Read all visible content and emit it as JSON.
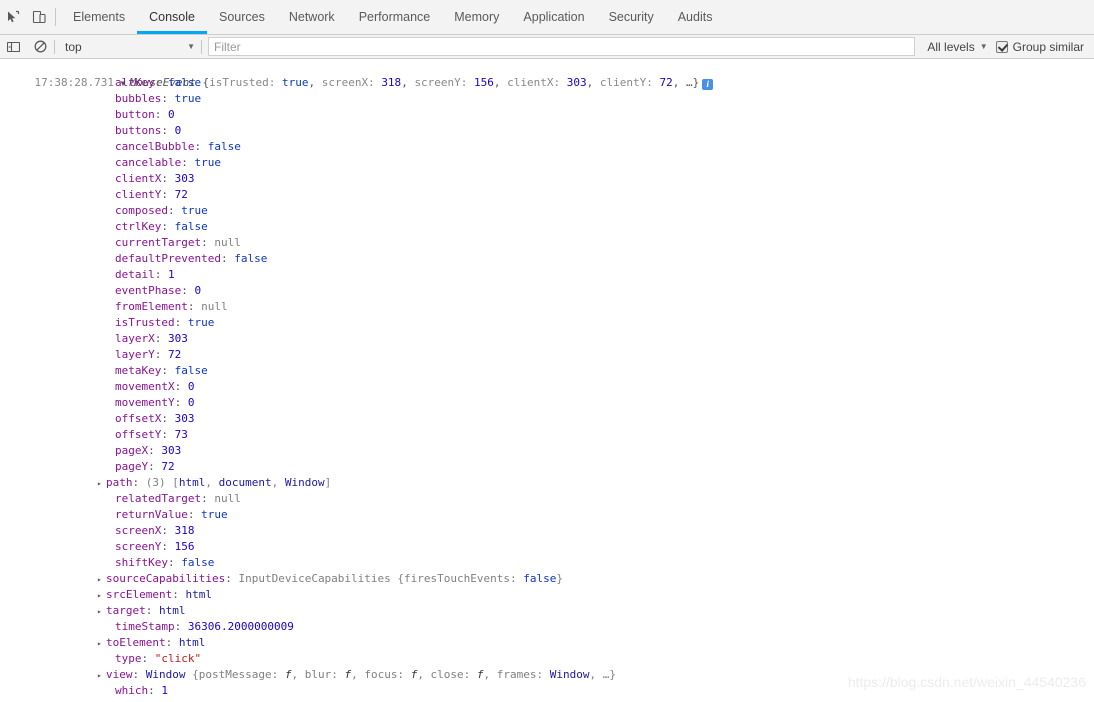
{
  "theme": {
    "accent": "#00a8f0"
  },
  "tabbar": {
    "icons": [
      {
        "name": "inspect-element-icon"
      },
      {
        "name": "device-toolbar-icon"
      }
    ],
    "tabs": [
      {
        "label": "Elements",
        "active": false
      },
      {
        "label": "Console",
        "active": true
      },
      {
        "label": "Sources",
        "active": false
      },
      {
        "label": "Network",
        "active": false
      },
      {
        "label": "Performance",
        "active": false
      },
      {
        "label": "Memory",
        "active": false
      },
      {
        "label": "Application",
        "active": false
      },
      {
        "label": "Security",
        "active": false
      },
      {
        "label": "Audits",
        "active": false
      }
    ]
  },
  "toolbar": {
    "sidebar_icon": "console-sidebar-icon",
    "clear_icon": "clear-console-icon",
    "context": {
      "value": "top",
      "caret": "▼"
    },
    "filter": {
      "value": "",
      "placeholder": "Filter"
    },
    "levels": {
      "label": "All levels",
      "caret": "▼"
    },
    "group_similar": {
      "label": "Group similar",
      "checked": true
    }
  },
  "console": {
    "message": {
      "timestamp": "17:38:28.731",
      "disclosure": "▼",
      "ctor": "MouseEvent",
      "preview_open": " {",
      "preview": [
        {
          "key": "isTrusted",
          "value": "true",
          "type": "bool"
        },
        {
          "key": "screenX",
          "value": "318",
          "type": "num"
        },
        {
          "key": "screenY",
          "value": "156",
          "type": "num"
        },
        {
          "key": "clientX",
          "value": "303",
          "type": "num"
        },
        {
          "key": "clientY",
          "value": "72",
          "type": "num"
        }
      ],
      "preview_close": ", …}",
      "info_badge": "i"
    },
    "properties": [
      {
        "key": "altKey",
        "value": "false",
        "type": "bool",
        "expandable": false
      },
      {
        "key": "bubbles",
        "value": "true",
        "type": "bool",
        "expandable": false
      },
      {
        "key": "button",
        "value": "0",
        "type": "num",
        "expandable": false
      },
      {
        "key": "buttons",
        "value": "0",
        "type": "num",
        "expandable": false
      },
      {
        "key": "cancelBubble",
        "value": "false",
        "type": "bool",
        "expandable": false
      },
      {
        "key": "cancelable",
        "value": "true",
        "type": "bool",
        "expandable": false
      },
      {
        "key": "clientX",
        "value": "303",
        "type": "num",
        "expandable": false
      },
      {
        "key": "clientY",
        "value": "72",
        "type": "num",
        "expandable": false
      },
      {
        "key": "composed",
        "value": "true",
        "type": "bool",
        "expandable": false
      },
      {
        "key": "ctrlKey",
        "value": "false",
        "type": "bool",
        "expandable": false
      },
      {
        "key": "currentTarget",
        "value": "null",
        "type": "null",
        "expandable": false
      },
      {
        "key": "defaultPrevented",
        "value": "false",
        "type": "bool",
        "expandable": false
      },
      {
        "key": "detail",
        "value": "1",
        "type": "num",
        "expandable": false
      },
      {
        "key": "eventPhase",
        "value": "0",
        "type": "num",
        "expandable": false
      },
      {
        "key": "fromElement",
        "value": "null",
        "type": "null",
        "expandable": false
      },
      {
        "key": "isTrusted",
        "value": "true",
        "type": "bool",
        "expandable": false
      },
      {
        "key": "layerX",
        "value": "303",
        "type": "num",
        "expandable": false
      },
      {
        "key": "layerY",
        "value": "72",
        "type": "num",
        "expandable": false
      },
      {
        "key": "metaKey",
        "value": "false",
        "type": "bool",
        "expandable": false
      },
      {
        "key": "movementX",
        "value": "0",
        "type": "num",
        "expandable": false
      },
      {
        "key": "movementY",
        "value": "0",
        "type": "num",
        "expandable": false
      },
      {
        "key": "offsetX",
        "value": "303",
        "type": "num",
        "expandable": false
      },
      {
        "key": "offsetY",
        "value": "73",
        "type": "num",
        "expandable": false
      },
      {
        "key": "pageX",
        "value": "303",
        "type": "num",
        "expandable": false
      },
      {
        "key": "pageY",
        "value": "72",
        "type": "num",
        "expandable": false
      },
      {
        "key": "path",
        "value": "(3) [html, document, Window]",
        "type": "array",
        "expandable": true
      },
      {
        "key": "relatedTarget",
        "value": "null",
        "type": "null",
        "expandable": false
      },
      {
        "key": "returnValue",
        "value": "true",
        "type": "bool",
        "expandable": false
      },
      {
        "key": "screenX",
        "value": "318",
        "type": "num",
        "expandable": false
      },
      {
        "key": "screenY",
        "value": "156",
        "type": "num",
        "expandable": false
      },
      {
        "key": "shiftKey",
        "value": "false",
        "type": "bool",
        "expandable": false
      },
      {
        "key": "sourceCapabilities",
        "value": "InputDeviceCapabilities {firesTouchEvents: false}",
        "type": "object",
        "expandable": true
      },
      {
        "key": "srcElement",
        "value": "html",
        "type": "node",
        "expandable": true
      },
      {
        "key": "target",
        "value": "html",
        "type": "node",
        "expandable": true
      },
      {
        "key": "timeStamp",
        "value": "36306.2000000009",
        "type": "num",
        "expandable": false
      },
      {
        "key": "toElement",
        "value": "html",
        "type": "node",
        "expandable": true
      },
      {
        "key": "type",
        "value": "\"click\"",
        "type": "str",
        "expandable": false
      },
      {
        "key": "view",
        "value": "Window {postMessage: f, blur: f, focus: f, close: f, frames: Window, …}",
        "type": "object",
        "expandable": true
      },
      {
        "key": "which",
        "value": "1",
        "type": "num",
        "expandable": false
      }
    ]
  },
  "watermark": {
    "text": "https://blog.csdn.net/weixin_44540236"
  }
}
